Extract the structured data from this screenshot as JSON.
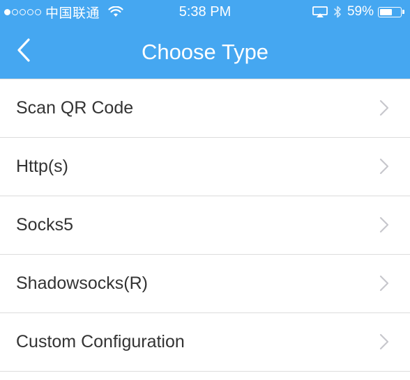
{
  "status_bar": {
    "signal_strength": 1,
    "signal_total": 5,
    "carrier": "中国联通",
    "time": "5:38 PM",
    "battery_percent": "59%",
    "battery_level": 0.59,
    "icons": [
      "wifi-icon",
      "airplay-icon",
      "bluetooth-icon",
      "battery-icon"
    ]
  },
  "nav": {
    "title": "Choose Type",
    "back_icon": "chevron-left-icon"
  },
  "list": {
    "items": [
      {
        "label": "Scan QR Code"
      },
      {
        "label": "Http(s)"
      },
      {
        "label": "Socks5"
      },
      {
        "label": "Shadowsocks(R)"
      },
      {
        "label": "Custom Configuration"
      }
    ],
    "item_icon": "chevron-right-icon"
  },
  "colors": {
    "header_bg": "#45a7f1",
    "header_text": "#ffffff",
    "item_text": "#333333",
    "separator": "#dcdcdc",
    "chevron": "#c7c7cc"
  }
}
